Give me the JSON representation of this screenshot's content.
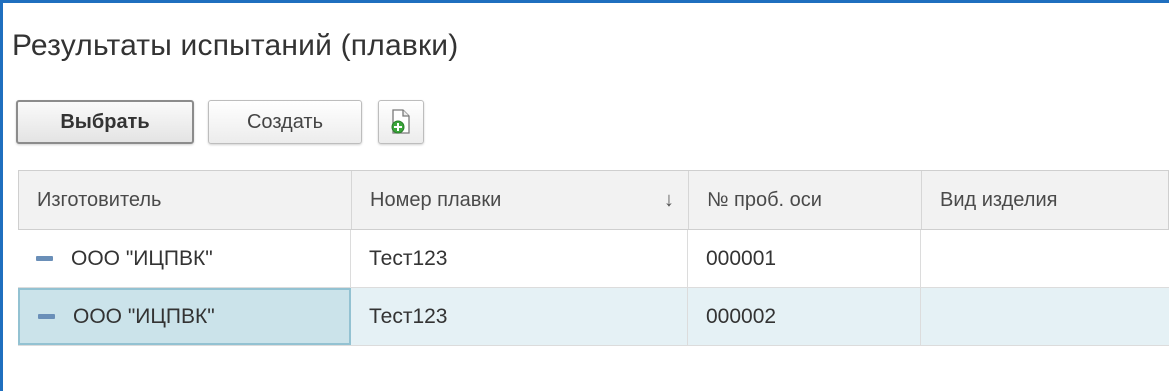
{
  "title": "Результаты испытаний (плавки)",
  "toolbar": {
    "select_label": "Выбрать",
    "create_label": "Создать",
    "add_icon": "document-add-icon"
  },
  "table": {
    "columns": [
      "Изготовитель",
      "Номер плавки",
      "№ проб. оси",
      "Вид изделия"
    ],
    "sort_indicator": "↓",
    "rows": [
      {
        "manufacturer": "ООО \"ИЦПВК\"",
        "melt_number": "Тест123",
        "axle_sample": "000001",
        "product_type": ""
      },
      {
        "manufacturer": "ООО \"ИЦПВК\"",
        "melt_number": "Тест123",
        "axle_sample": "000002",
        "product_type": ""
      }
    ],
    "selected_row": 1
  },
  "colors": {
    "window_border": "#1f6fbf",
    "selected_row": "#e5f1f5",
    "focused_cell": "#cbe3ea",
    "row_marker": "#6a8fb8"
  }
}
